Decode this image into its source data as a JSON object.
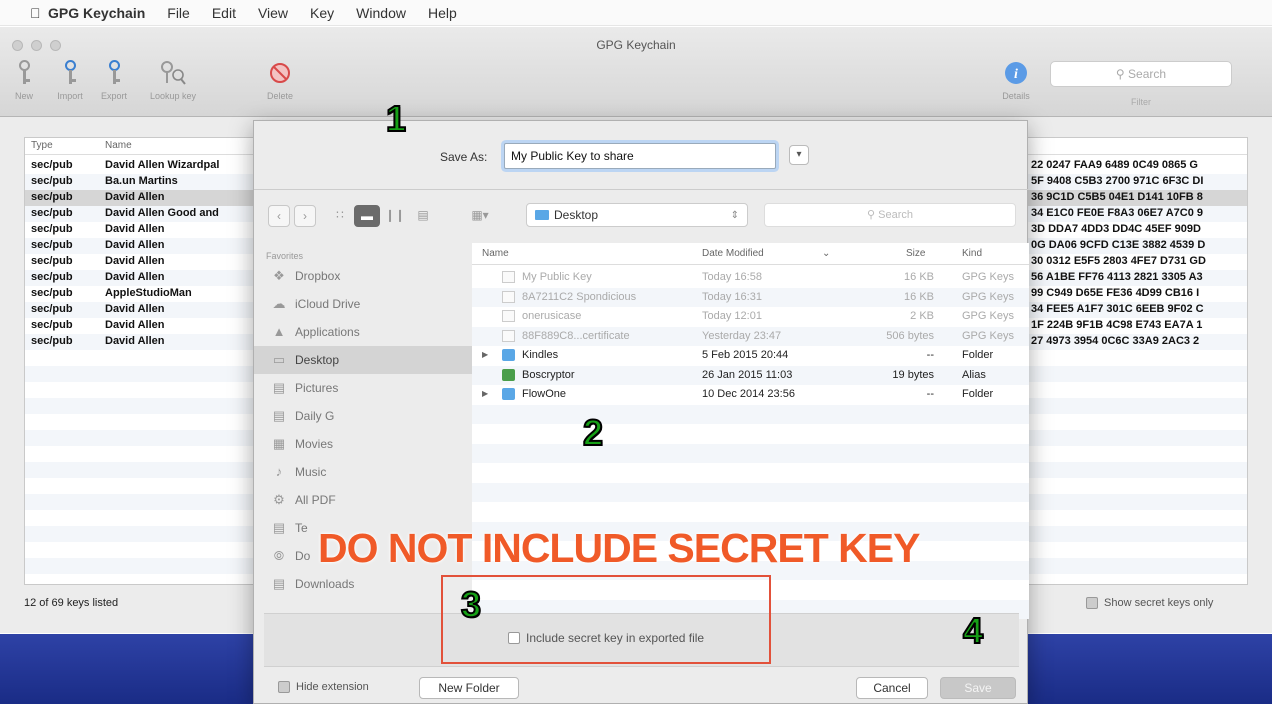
{
  "menubar": {
    "apple": "",
    "items": [
      "GPG Keychain",
      "File",
      "Edit",
      "View",
      "Key",
      "Window",
      "Help"
    ]
  },
  "window": {
    "title": "GPG Keychain",
    "toolbar": [
      {
        "label": "New",
        "icon": "key-icon"
      },
      {
        "label": "Import",
        "icon": "key-import-icon"
      },
      {
        "label": "Export",
        "icon": "key-export-icon"
      },
      {
        "label": "Lookup key",
        "icon": "lookup-key-icon"
      },
      {
        "label": "Delete",
        "icon": "delete-icon"
      },
      {
        "label": "Details",
        "icon": "info-icon"
      }
    ],
    "search_placeholder": "Search",
    "search_label": "Filter"
  },
  "keylist": {
    "columns": [
      "Type",
      "Name"
    ],
    "rows": [
      {
        "type": "sec/pub",
        "name": "David Allen Wizardpal",
        "fp": "22 0247 FAA9 6489 0C49 0865 G"
      },
      {
        "type": "sec/pub",
        "name": "Ba.un Martins",
        "fp": "5F 9408 C5B3 2700 971C 6F3C DI"
      },
      {
        "type": "sec/pub",
        "name": "David Allen",
        "fp": "36 9C1D C5B5 04E1 D141 10FB 8"
      },
      {
        "type": "sec/pub",
        "name": "David Allen Good and",
        "fp": "34 E1C0 FE0E F8A3 06E7 A7C0 9"
      },
      {
        "type": "sec/pub",
        "name": "David Allen",
        "fp": "3D DDA7 4DD3 DD4C 45EF 909D"
      },
      {
        "type": "sec/pub",
        "name": "David Allen",
        "fp": "0G DA06 9CFD C13E 3882 4539 D"
      },
      {
        "type": "sec/pub",
        "name": "David Allen",
        "fp": "30 0312 E5F5 2803 4FE7 D731 GD"
      },
      {
        "type": "sec/pub",
        "name": "David Allen",
        "fp": "56 A1BE FF76 4113 2821 3305 A3"
      },
      {
        "type": "sec/pub",
        "name": "AppleStudioMan",
        "fp": "99 C949 D65E FE36 4D99 CB16 I"
      },
      {
        "type": "sec/pub",
        "name": "David Allen",
        "fp": "34 FEE5 A1F7 301C 6EEB 9F02 C"
      },
      {
        "type": "sec/pub",
        "name": "David Allen",
        "fp": "1F 224B 9F1B 4C98 E743 EA7A 1"
      },
      {
        "type": "sec/pub",
        "name": "David Allen",
        "fp": "27 4973 3954 0C6C 33A9 2AC3 2"
      }
    ],
    "status": "12 of 69 keys listed",
    "show_secret_label": "Show secret keys only"
  },
  "dialog": {
    "save_as_label": "Save As:",
    "save_as_value": "My Public Key to share",
    "location": "Desktop",
    "search_placeholder": "Search",
    "favorites_header": "Favorites",
    "favorites": [
      {
        "label": "Dropbox",
        "icon": "dropbox-icon"
      },
      {
        "label": "iCloud Drive",
        "icon": "cloud-icon"
      },
      {
        "label": "Applications",
        "icon": "applications-icon"
      },
      {
        "label": "Desktop",
        "icon": "desktop-icon"
      },
      {
        "label": "Pictures",
        "icon": "folder-icon"
      },
      {
        "label": "Daily G",
        "icon": "folder-icon"
      },
      {
        "label": "Movies",
        "icon": "movies-icon"
      },
      {
        "label": "Music",
        "icon": "music-icon"
      },
      {
        "label": "All PDF",
        "icon": "gear-icon"
      },
      {
        "label": "Te",
        "icon": "folder-icon"
      },
      {
        "label": "Do",
        "icon": "download-icon"
      },
      {
        "label": "Downloads",
        "icon": "folder-icon"
      }
    ],
    "file_columns": [
      "Name",
      "Date Modified",
      "Size",
      "Kind"
    ],
    "files": [
      {
        "name": "My Public Key",
        "date": "Today 16:58",
        "size": "16 KB",
        "kind": "GPG Keys",
        "enabled": false,
        "icon": "doc"
      },
      {
        "name": "8A7211C2 Spondicious",
        "date": "Today 16:31",
        "size": "16 KB",
        "kind": "GPG Keys",
        "enabled": false,
        "icon": "doc"
      },
      {
        "name": "onerusicase",
        "date": "Today 12:01",
        "size": "2 KB",
        "kind": "GPG Keys",
        "enabled": false,
        "icon": "doc"
      },
      {
        "name": "88F889C8...certificate",
        "date": "Yesterday 23:47",
        "size": "506 bytes",
        "kind": "GPG Keys",
        "enabled": false,
        "icon": "doc"
      },
      {
        "name": "Kindles",
        "date": "5 Feb 2015 20:44",
        "size": "--",
        "kind": "Folder",
        "enabled": true,
        "icon": "folder"
      },
      {
        "name": "Boscryptor",
        "date": "26 Jan 2015 11:03",
        "size": "19 bytes",
        "kind": "Alias",
        "enabled": true,
        "icon": "app"
      },
      {
        "name": "FlowOne",
        "date": "10 Dec 2014 23:56",
        "size": "--",
        "kind": "Folder",
        "enabled": true,
        "icon": "folder"
      }
    ],
    "include_secret_label": "Include secret key in exported file",
    "hide_extension_label": "Hide extension",
    "new_folder_label": "New Folder",
    "cancel_label": "Cancel",
    "save_label": "Save"
  },
  "annotations": {
    "step1": "1",
    "step2": "2",
    "step3": "3",
    "step4": "4",
    "warning": "DO NOT INCLUDE SECRET KEY",
    "warning_color": "#f05a28",
    "step_color": "#16a016"
  }
}
